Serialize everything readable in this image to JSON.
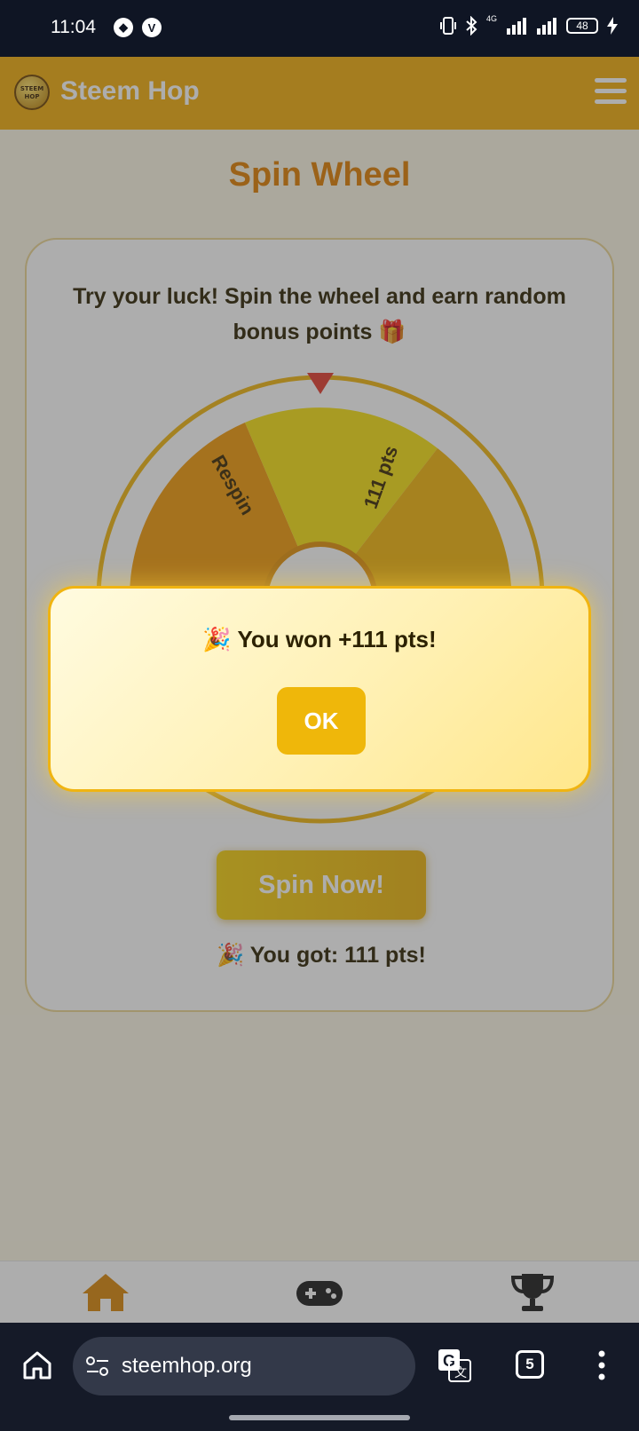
{
  "status_bar": {
    "time": "11:04",
    "battery": "48",
    "network": "4G"
  },
  "header": {
    "logo_text": "STEEM HOP",
    "brand": "Steem Hop",
    "accent_color": "#f1ad0c"
  },
  "page": {
    "title": "Spin Wheel",
    "intro": "Try your luck! Spin the wheel and earn random bonus points 🎁",
    "wheel_visible_labels": [
      "Respin",
      "111 pts"
    ],
    "spin_button": "Spin Now!",
    "result": "🎉 You got: 111 pts!"
  },
  "modal": {
    "message": "🎉 You won +111 pts!",
    "ok_label": "OK"
  },
  "bottom_nav": {
    "items": [
      "home-icon",
      "gamepad-icon",
      "trophy-icon"
    ]
  },
  "browser": {
    "url": "steemhop.org",
    "tab_count": "5"
  }
}
